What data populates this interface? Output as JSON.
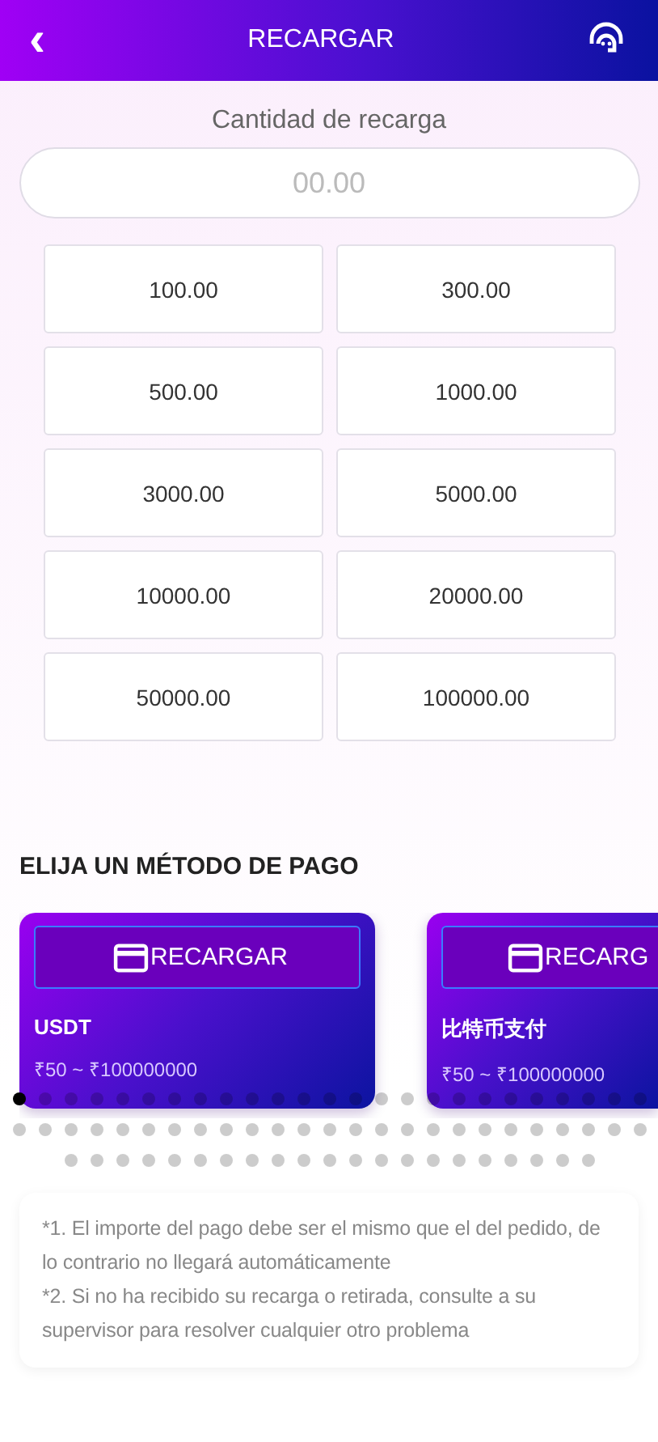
{
  "header": {
    "back": "‹",
    "title": "RECARGAR"
  },
  "amount": {
    "label": "Cantidad de recarga",
    "placeholder": "00.00"
  },
  "presets": [
    {
      "label": "100.00",
      "selected": false
    },
    {
      "label": "300.00",
      "selected": false
    },
    {
      "label": "500.00",
      "selected": false
    },
    {
      "label": "1000.00",
      "selected": false
    },
    {
      "label": "3000.00",
      "selected": false
    },
    {
      "label": "5000.00",
      "selected": false
    },
    {
      "label": "10000.00",
      "selected": false
    },
    {
      "label": "20000.00",
      "selected": false
    },
    {
      "label": "50000.00",
      "selected": false
    },
    {
      "label": "100000.00",
      "selected": false
    }
  ],
  "payment_title": "ELIJA UN MÉTODO DE PAGO",
  "methods": [
    {
      "button": "RECARGAR",
      "name": "USDT",
      "range": "₹50 ~ ₹100000000"
    },
    {
      "button": "RECARG",
      "name": "比特币支付",
      "range": "₹50 ~ ₹100000000"
    }
  ],
  "dots": [
    {
      "selected": true
    },
    {
      "selected": false
    },
    {
      "selected": false
    },
    {
      "selected": false
    },
    {
      "selected": false
    },
    {
      "selected": false
    },
    {
      "selected": false
    },
    {
      "selected": false
    },
    {
      "selected": false
    },
    {
      "selected": false
    },
    {
      "selected": false
    },
    {
      "selected": false
    },
    {
      "selected": false
    },
    {
      "selected": false
    },
    {
      "selected": false
    },
    {
      "selected": false
    },
    {
      "selected": false
    },
    {
      "selected": false
    },
    {
      "selected": false
    },
    {
      "selected": false
    },
    {
      "selected": false
    },
    {
      "selected": false
    },
    {
      "selected": false
    },
    {
      "selected": false
    },
    {
      "selected": false
    },
    {
      "selected": false
    },
    {
      "selected": false
    },
    {
      "selected": false
    },
    {
      "selected": false
    },
    {
      "selected": false
    },
    {
      "selected": false
    },
    {
      "selected": false
    },
    {
      "selected": false
    },
    {
      "selected": false
    },
    {
      "selected": false
    },
    {
      "selected": false
    },
    {
      "selected": false
    },
    {
      "selected": false
    },
    {
      "selected": false
    },
    {
      "selected": false
    },
    {
      "selected": false
    },
    {
      "selected": false
    },
    {
      "selected": false
    },
    {
      "selected": false
    },
    {
      "selected": false
    },
    {
      "selected": false
    },
    {
      "selected": false
    },
    {
      "selected": false
    },
    {
      "selected": false
    },
    {
      "selected": false
    },
    {
      "selected": false
    },
    {
      "selected": false
    },
    {
      "selected": false
    },
    {
      "selected": false
    },
    {
      "selected": false
    },
    {
      "selected": false
    },
    {
      "selected": false
    },
    {
      "selected": false
    },
    {
      "selected": false
    },
    {
      "selected": false
    },
    {
      "selected": false
    },
    {
      "selected": false
    },
    {
      "selected": false
    },
    {
      "selected": false
    },
    {
      "selected": false
    },
    {
      "selected": false
    },
    {
      "selected": false
    },
    {
      "selected": false
    },
    {
      "selected": false
    },
    {
      "selected": false
    },
    {
      "selected": false
    }
  ],
  "notes": [
    "*1. El importe del pago debe ser el mismo que el del pedido, de lo contrario no llegará automáticamente",
    "*2. Si no ha recibido su recarga o retirada, consulte a su supervisor para resolver cualquier otro problema"
  ]
}
